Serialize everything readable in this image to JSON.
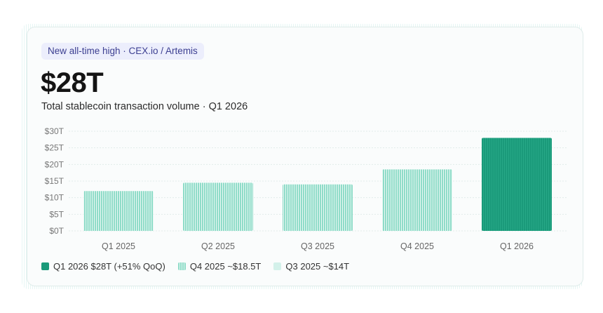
{
  "badge": "New all-time high · CEX.io / Artemis",
  "headline": "$28T",
  "subtitle": "Total stablecoin transaction volume · Q1 2026",
  "colors": {
    "highlight": "#1a9a7a",
    "bar_light": "#8fdcc8",
    "bar_light_stripe": "#ffffff",
    "q3_swatch": "#d3f1ea"
  },
  "legend": [
    {
      "label": "Q1 2026 $28T (+51% QoQ)",
      "color": "#1a9a7a",
      "style": "solid"
    },
    {
      "label": "Q4 2025 ~$18.5T",
      "color": "#8fdcc8",
      "style": "striped"
    },
    {
      "label": "Q3 2025 ~$14T",
      "color": "#d3f1ea",
      "style": "light"
    }
  ],
  "chart_data": {
    "type": "bar",
    "categories": [
      "Q1 2025",
      "Q2 2025",
      "Q3 2025",
      "Q4 2025",
      "Q1 2026"
    ],
    "values": [
      12,
      14.5,
      14,
      18.5,
      28
    ],
    "highlight_index": 4,
    "ylim": [
      0,
      30
    ],
    "yticks": [
      "$0T",
      "$5T",
      "$10T",
      "$15T",
      "$20T",
      "$25T",
      "$30T"
    ],
    "grid": true
  }
}
